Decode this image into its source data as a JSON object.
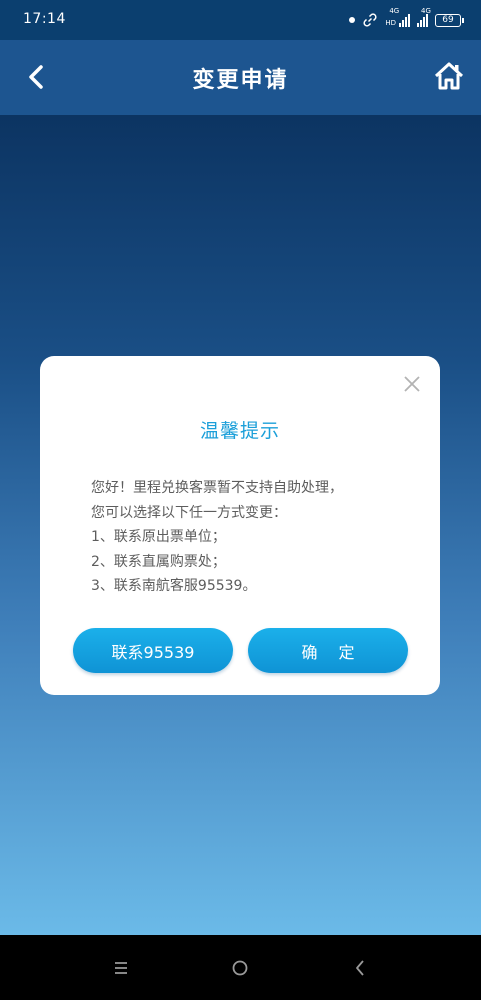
{
  "status_bar": {
    "time": "17:14",
    "network_left": "4G",
    "network_left_sub": "HD",
    "network_right": "4G",
    "battery": "69"
  },
  "header": {
    "title": "变更申请",
    "back_icon": "chevron-left-icon",
    "home_icon": "home-icon"
  },
  "dialog": {
    "title": "温馨提示",
    "lines": [
      "您好！里程兑换客票暂不支持自助处理，",
      "您可以选择以下任一方式变更：",
      "1、联系原出票单位；",
      "2、联系直属购票处；",
      "3、联系南航客服95539。"
    ],
    "contact_button": "联系95539",
    "confirm_button": "确 定",
    "close_icon": "close-icon"
  },
  "nav_bar": {
    "menu_icon": "menu-icon",
    "home_icon": "circle-home-icon",
    "back_icon": "back-triangle-icon"
  },
  "colors": {
    "header_bg": "#1d5590",
    "accent": "#1b9fd9",
    "button": "#1aa6e3",
    "body_text": "#5d5d5d"
  }
}
